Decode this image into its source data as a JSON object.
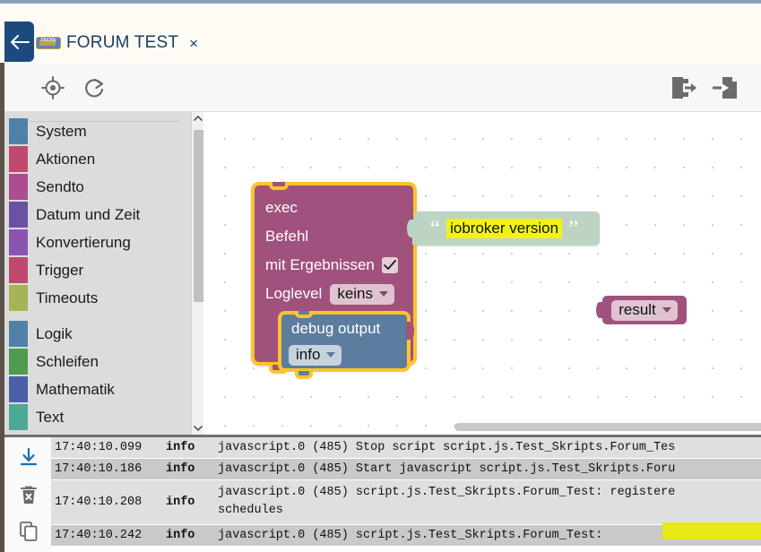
{
  "window": {
    "tab": {
      "label": "FORUM TEST",
      "close_label": "×",
      "icon": "blockly-badge-icon",
      "badge_text": "blockly"
    },
    "back_icon": "back-arrow-icon"
  },
  "toolbar": {
    "items": [
      {
        "name": "center-blocks-button",
        "icon": "crosshair-target-icon",
        "label": ""
      },
      {
        "name": "redo-button",
        "icon": "redo-arrow-icon",
        "label": ""
      },
      {
        "name": "export-blocks-button",
        "icon": "export-document-icon",
        "label": ""
      },
      {
        "name": "import-blocks-button",
        "icon": "import-document-icon",
        "label": ""
      }
    ]
  },
  "sidebar": {
    "groups": [
      {
        "items": [
          {
            "label": "System",
            "color": "#4f81a8"
          },
          {
            "label": "Aktionen",
            "color": "#bf4a6e"
          },
          {
            "label": "Sendto",
            "color": "#ab4d8f"
          },
          {
            "label": "Datum und Zeit",
            "color": "#6a51a3"
          },
          {
            "label": "Konvertierung",
            "color": "#8b54b0"
          },
          {
            "label": "Trigger",
            "color": "#bf4a6e"
          },
          {
            "label": "Timeouts",
            "color": "#a8b355"
          }
        ]
      },
      {
        "items": [
          {
            "label": "Logik",
            "color": "#4f81a8"
          },
          {
            "label": "Schleifen",
            "color": "#4f9a4f"
          },
          {
            "label": "Mathematik",
            "color": "#4a5fa8"
          },
          {
            "label": "Text",
            "color": "#4fa896"
          }
        ]
      }
    ],
    "scroll": {
      "up_icon": "chevron-up-icon",
      "down_icon": "chevron-down-icon"
    }
  },
  "workspace": {
    "blocks": {
      "exec": {
        "title": "exec",
        "field_command_label": "Befehl",
        "field_results_label": "mit Ergebnissen",
        "field_results_checked": true,
        "check_icon": "checkmark-icon",
        "field_loglevel_label": "Loglevel",
        "field_loglevel_value": "keins",
        "color": "#a0517d",
        "highlight_color": "#ffc32e"
      },
      "text_string": {
        "value": "iobroker version",
        "quote_open": "“",
        "quote_close": "”",
        "color": "#bdd4c2",
        "highlight_color": "#f3f312"
      },
      "debug_output": {
        "title": "debug output",
        "severity": "info",
        "color": "#5c7d9e"
      },
      "result_variable": {
        "value": "result",
        "color": "#a0517d"
      }
    }
  },
  "log": {
    "tools": [
      {
        "name": "download-log-button",
        "icon": "download-icon"
      },
      {
        "name": "clear-log-button",
        "icon": "trash-x-icon"
      },
      {
        "name": "copy-log-button",
        "icon": "copy-icon"
      }
    ],
    "entries": [
      {
        "timestamp": "17:40:10.099",
        "severity": "info",
        "message": "javascript.0 (485) Stop script script.js.Test_Skripts.Forum_Tes"
      },
      {
        "timestamp": "17:40:10.186",
        "severity": "info",
        "message": "javascript.0 (485) Start javascript script.js.Test_Skripts.Foru"
      },
      {
        "timestamp": "17:40:10.208",
        "severity": "info",
        "message": "javascript.0 (485) script.js.Test_Skripts.Forum_Test: registere\nschedules"
      },
      {
        "timestamp": "17:40:10.242",
        "severity": "info",
        "message": "javascript.0 (485) script.js.Test_Skripts.Forum_Test:"
      }
    ]
  }
}
